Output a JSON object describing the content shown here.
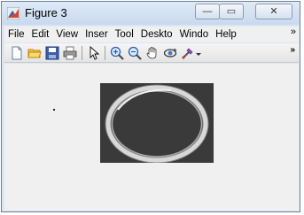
{
  "window": {
    "title": "Figure 3",
    "controls": {
      "minimize": "—",
      "maximize": "▭",
      "close": "✕"
    }
  },
  "menu": {
    "items": [
      "File",
      "Edit",
      "View",
      "Inser",
      "Tool",
      "Deskto",
      "Windo",
      "Help"
    ],
    "overflow": "»"
  },
  "toolbar": {
    "buttons": [
      "new-figure-icon",
      "open-file-icon",
      "save-icon",
      "print-icon",
      "pointer-icon",
      "zoom-in-icon",
      "zoom-out-icon",
      "pan-hand-icon",
      "rotate-3d-icon",
      "data-cursor-icon",
      "dropdown-arrow-icon"
    ],
    "overflow": "»"
  },
  "figure": {
    "image_bg_color": "#3a3a3a",
    "ring_color": "#d8d8d8"
  }
}
